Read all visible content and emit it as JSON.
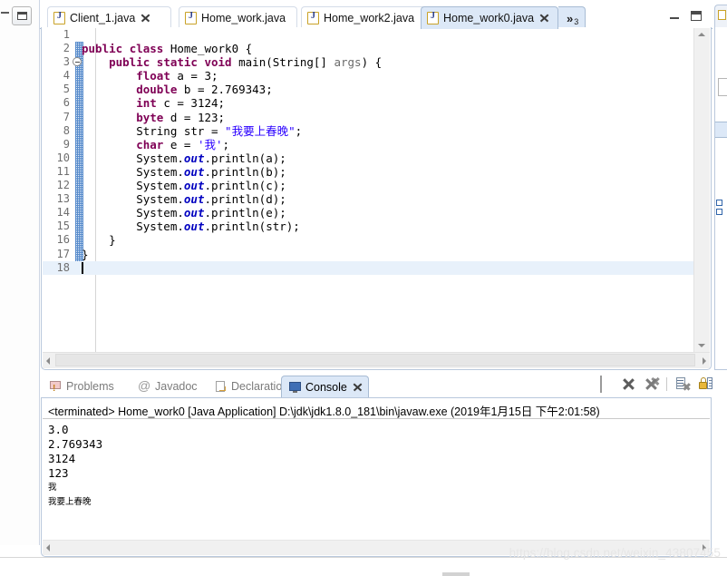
{
  "window": {
    "left_panel": {
      "minimize_label": "minimize",
      "restore_label": "restore"
    }
  },
  "editor": {
    "tabs": [
      {
        "label": "Client_1.java",
        "icon": "java-file-icon",
        "closable": true,
        "active": false
      },
      {
        "label": "Home_work.java",
        "icon": "java-file-icon",
        "closable": false,
        "active": false
      },
      {
        "label": "Home_work2.java",
        "icon": "java-file-icon",
        "closable": false,
        "active": false
      },
      {
        "label": "Home_work0.java",
        "icon": "java-file-icon",
        "closable": true,
        "active": true
      }
    ],
    "overflow": {
      "chevron": "»",
      "count": "3"
    },
    "controls": {
      "minimize": "minimize-editor",
      "maximize": "maximize-editor"
    },
    "gutter": {
      "first_line": 1,
      "last_line": 18,
      "cursor_line": 18
    },
    "fold_markers": [
      3
    ],
    "code": [
      {
        "n": 1,
        "tokens": []
      },
      {
        "n": 2,
        "tokens": [
          {
            "t": "public",
            "c": "kw"
          },
          {
            "t": " ",
            "c": "pln"
          },
          {
            "t": "class",
            "c": "kw"
          },
          {
            "t": " Home_work0 {",
            "c": "pln"
          }
        ]
      },
      {
        "n": 3,
        "tokens": [
          {
            "t": "    ",
            "c": "pln"
          },
          {
            "t": "public",
            "c": "kw"
          },
          {
            "t": " ",
            "c": "pln"
          },
          {
            "t": "static",
            "c": "kw"
          },
          {
            "t": " ",
            "c": "pln"
          },
          {
            "t": "void",
            "c": "kw"
          },
          {
            "t": " main(String[] ",
            "c": "pln"
          },
          {
            "t": "args",
            "c": "prm"
          },
          {
            "t": ") {",
            "c": "pln"
          }
        ]
      },
      {
        "n": 4,
        "tokens": [
          {
            "t": "        ",
            "c": "pln"
          },
          {
            "t": "float",
            "c": "kw"
          },
          {
            "t": " a = 3;",
            "c": "pln"
          }
        ]
      },
      {
        "n": 5,
        "tokens": [
          {
            "t": "        ",
            "c": "pln"
          },
          {
            "t": "double",
            "c": "kw"
          },
          {
            "t": " b = 2.769343;",
            "c": "pln"
          }
        ]
      },
      {
        "n": 6,
        "tokens": [
          {
            "t": "        ",
            "c": "pln"
          },
          {
            "t": "int",
            "c": "kw"
          },
          {
            "t": " c = 3124;",
            "c": "pln"
          }
        ]
      },
      {
        "n": 7,
        "tokens": [
          {
            "t": "        ",
            "c": "pln"
          },
          {
            "t": "byte",
            "c": "kw"
          },
          {
            "t": " d = 123;",
            "c": "pln"
          }
        ]
      },
      {
        "n": 8,
        "tokens": [
          {
            "t": "        String str = ",
            "c": "pln"
          },
          {
            "t": "\"我要上春晚\"",
            "c": "str"
          },
          {
            "t": ";",
            "c": "pln"
          }
        ]
      },
      {
        "n": 9,
        "tokens": [
          {
            "t": "        ",
            "c": "pln"
          },
          {
            "t": "char",
            "c": "kw"
          },
          {
            "t": " e = ",
            "c": "pln"
          },
          {
            "t": "'我'",
            "c": "str"
          },
          {
            "t": ";",
            "c": "pln"
          }
        ]
      },
      {
        "n": 10,
        "tokens": [
          {
            "t": "        System.",
            "c": "pln"
          },
          {
            "t": "out",
            "c": "fld"
          },
          {
            "t": ".println(a);",
            "c": "pln"
          }
        ]
      },
      {
        "n": 11,
        "tokens": [
          {
            "t": "        System.",
            "c": "pln"
          },
          {
            "t": "out",
            "c": "fld"
          },
          {
            "t": ".println(b);",
            "c": "pln"
          }
        ]
      },
      {
        "n": 12,
        "tokens": [
          {
            "t": "        System.",
            "c": "pln"
          },
          {
            "t": "out",
            "c": "fld"
          },
          {
            "t": ".println(c);",
            "c": "pln"
          }
        ]
      },
      {
        "n": 13,
        "tokens": [
          {
            "t": "        System.",
            "c": "pln"
          },
          {
            "t": "out",
            "c": "fld"
          },
          {
            "t": ".println(d);",
            "c": "pln"
          }
        ]
      },
      {
        "n": 14,
        "tokens": [
          {
            "t": "        System.",
            "c": "pln"
          },
          {
            "t": "out",
            "c": "fld"
          },
          {
            "t": ".println(e);",
            "c": "pln"
          }
        ]
      },
      {
        "n": 15,
        "tokens": [
          {
            "t": "        System.",
            "c": "pln"
          },
          {
            "t": "out",
            "c": "fld"
          },
          {
            "t": ".println(str);",
            "c": "pln"
          }
        ]
      },
      {
        "n": 16,
        "tokens": [
          {
            "t": "    }",
            "c": "pln"
          }
        ]
      },
      {
        "n": 17,
        "tokens": [
          {
            "t": "}",
            "c": "pln"
          }
        ]
      },
      {
        "n": 18,
        "tokens": []
      }
    ]
  },
  "console_view": {
    "tabs": [
      {
        "label": "Problems",
        "icon": "problems-icon",
        "active": false,
        "closable": false
      },
      {
        "label": "Javadoc",
        "icon": "javadoc-icon",
        "active": false,
        "closable": false
      },
      {
        "label": "Declaration",
        "icon": "declaration-icon",
        "active": false,
        "closable": false
      },
      {
        "label": "Console",
        "icon": "console-icon",
        "active": true,
        "closable": true
      }
    ],
    "toolbar": [
      {
        "name": "terminate-button",
        "glyph": "stop"
      },
      {
        "name": "remove-launch-button",
        "glyph": "x"
      },
      {
        "name": "remove-all-terminated-button",
        "glyph": "xx"
      },
      {
        "name": "clear-console-button",
        "glyph": "clear"
      },
      {
        "name": "scroll-lock-button",
        "glyph": "lock"
      }
    ],
    "launch_line": "<terminated> Home_work0 [Java Application] D:\\jdk\\jdk1.8.0_181\\bin\\javaw.exe (2019年1月15日 下午2:01:58)",
    "output": [
      "3.0",
      "2.769343",
      "3124",
      "123",
      "我",
      "我要上春晚"
    ]
  },
  "right_panel": {
    "tab_icon": "java-file-icon"
  },
  "watermark": "https://blog.csdn.net/weixin_43807455"
}
